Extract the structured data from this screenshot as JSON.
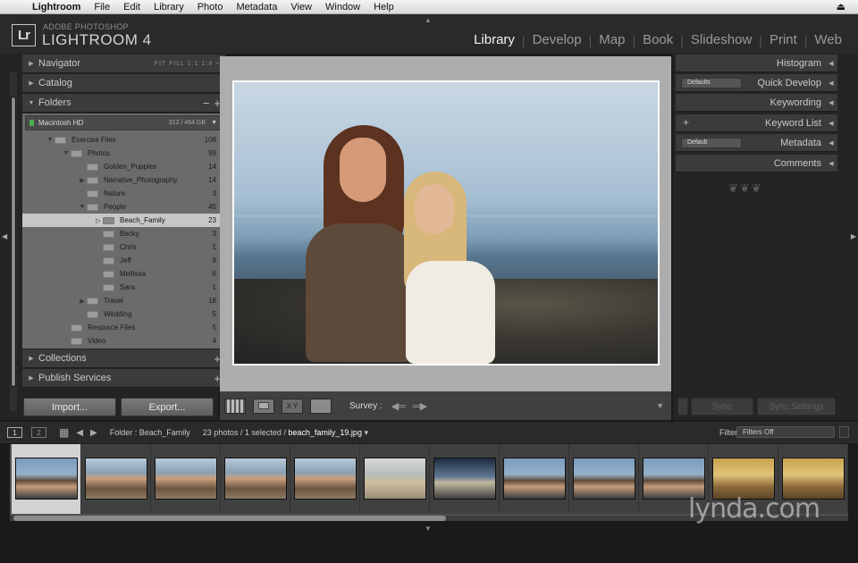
{
  "menubar": {
    "apple": "",
    "items": [
      "Lightroom",
      "File",
      "Edit",
      "Library",
      "Photo",
      "Metadata",
      "View",
      "Window",
      "Help"
    ],
    "right": "⏏"
  },
  "identity": {
    "badge": "Lr",
    "brand_top": "ADOBE PHOTOSHOP",
    "brand_main": "LIGHTROOM 4"
  },
  "modules": [
    "Library",
    "Develop",
    "Map",
    "Book",
    "Slideshow",
    "Print",
    "Web"
  ],
  "active_module": "Library",
  "left_panel": {
    "navigator": {
      "label": "Navigator",
      "zoom_options": "FIT  FILL  1:1  1:8 ÷"
    },
    "catalog": "Catalog",
    "folders": {
      "label": "Folders",
      "minus": "−",
      "plus": "+",
      "volume": {
        "name": "Macintosh HD",
        "size": "312 / 464 GB"
      },
      "rows": [
        {
          "name": "Exercise Files",
          "count": "108",
          "indent": 1,
          "tri": "▼"
        },
        {
          "name": "Photos",
          "count": "99",
          "indent": 2,
          "tri": "▼"
        },
        {
          "name": "Golden_Puppies",
          "count": "14",
          "indent": 3,
          "tri": ""
        },
        {
          "name": "Narrative_Photography",
          "count": "14",
          "indent": 3,
          "tri": "▶"
        },
        {
          "name": "Nature",
          "count": "3",
          "indent": 3,
          "tri": ""
        },
        {
          "name": "People",
          "count": "45",
          "indent": 3,
          "tri": "▼"
        },
        {
          "name": "Beach_Family",
          "count": "23",
          "indent": 4,
          "tri": "▷",
          "selected": true
        },
        {
          "name": "Becky",
          "count": "3",
          "indent": 4,
          "tri": ""
        },
        {
          "name": "Chris",
          "count": "1",
          "indent": 4,
          "tri": ""
        },
        {
          "name": "Jeff",
          "count": "9",
          "indent": 4,
          "tri": ""
        },
        {
          "name": "Mellissa",
          "count": "6",
          "indent": 4,
          "tri": ""
        },
        {
          "name": "Sara",
          "count": "1",
          "indent": 4,
          "tri": ""
        },
        {
          "name": "Travel",
          "count": "18",
          "indent": 3,
          "tri": "▶"
        },
        {
          "name": "Wedding",
          "count": "5",
          "indent": 3,
          "tri": ""
        },
        {
          "name": "Resource Files",
          "count": "5",
          "indent": 2,
          "tri": ""
        },
        {
          "name": "Video",
          "count": "4",
          "indent": 2,
          "tri": ""
        }
      ]
    },
    "collections": "Collections",
    "publish_services": "Publish Services",
    "import_label": "Import...",
    "export_label": "Export..."
  },
  "toolbar": {
    "survey_label": "Survey :",
    "xy_label": "X Y"
  },
  "right_panel": {
    "histogram": "Histogram",
    "quick_develop": {
      "label": "Quick Develop",
      "preset": "Defaults"
    },
    "keywording": "Keywording",
    "keyword_list": "Keyword List",
    "metadata": {
      "label": "Metadata",
      "preset": "Default"
    },
    "comments": "Comments",
    "ornament": "❦❦❦",
    "sync_label": "Sync",
    "sync_settings_label": "Sync Settings"
  },
  "filmstrip_bar": {
    "screen1": "1",
    "screen2": "2",
    "folder": "Folder : Beach_Family",
    "count_text": "23 photos / 1 selected /",
    "filename": "beach_family_19.jpg",
    "filter_label": "Filter :",
    "filter_value": "Filters Off"
  },
  "filmstrip": {
    "selected_index": 0,
    "thumbs": [
      "th-a",
      "th-b",
      "th-b",
      "th-b",
      "th-b",
      "th-d",
      "th-c",
      "th-a",
      "th-a",
      "th-a",
      "th-e",
      "th-e"
    ]
  },
  "watermark": "lynda.com"
}
